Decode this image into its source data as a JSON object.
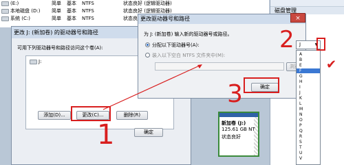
{
  "disk_list": [
    {
      "name": "(E:)",
      "layout": "简单",
      "type": "基本",
      "fs": "NTFS",
      "status": "状态良好 (逻辑驱动器)"
    },
    {
      "name": "本地磁盘 (D:)",
      "layout": "简单",
      "type": "基本",
      "fs": "NTFS",
      "status": "状态良好 (逻辑驱动器)"
    },
    {
      "name": "系统 (C:)",
      "layout": "简单",
      "type": "基本",
      "fs": "NTFS",
      "status": "状态良好 (系统, 启动"
    }
  ],
  "right_panel": {
    "title": "磁盘管理"
  },
  "bg_dialog": {
    "title": "更改 J: (新加卷) 的驱动器号和路径",
    "prompt": "可用下列驱动器号和路径访问这个卷(A):",
    "list_item": "J:",
    "add_label": "添加(D)...",
    "change_label": "更改(C)...",
    "delete_label": "删除(R)",
    "ok_label": "确定"
  },
  "partition": {
    "name": "新加卷 (J:)",
    "size": "125.61 GB NT",
    "status": "状态良好"
  },
  "front_dialog": {
    "title": "更改驱动器号和路径",
    "instruction": "为 J: (新加卷) 输入新的驱动器号或路径。",
    "option_letter": "分配以下驱动器号(A):",
    "option_folder": "装入以下空白 NTFS 文件夹中(M):",
    "browse_label": "浏览",
    "ok_label": "确定",
    "close_icon": "×"
  },
  "dropdown": {
    "selected": "J",
    "options": [
      "A",
      "B",
      "E",
      "F",
      "G",
      "H",
      "I",
      "J",
      "K",
      "L",
      "M",
      "N",
      "O",
      "P",
      "Q",
      "R",
      "S",
      "T",
      "U",
      "V"
    ],
    "highlighted": "F"
  },
  "annotations": {
    "step1": "1",
    "step2": "2",
    "step3": "3",
    "check": "✔",
    "color": "#d81e1e"
  }
}
